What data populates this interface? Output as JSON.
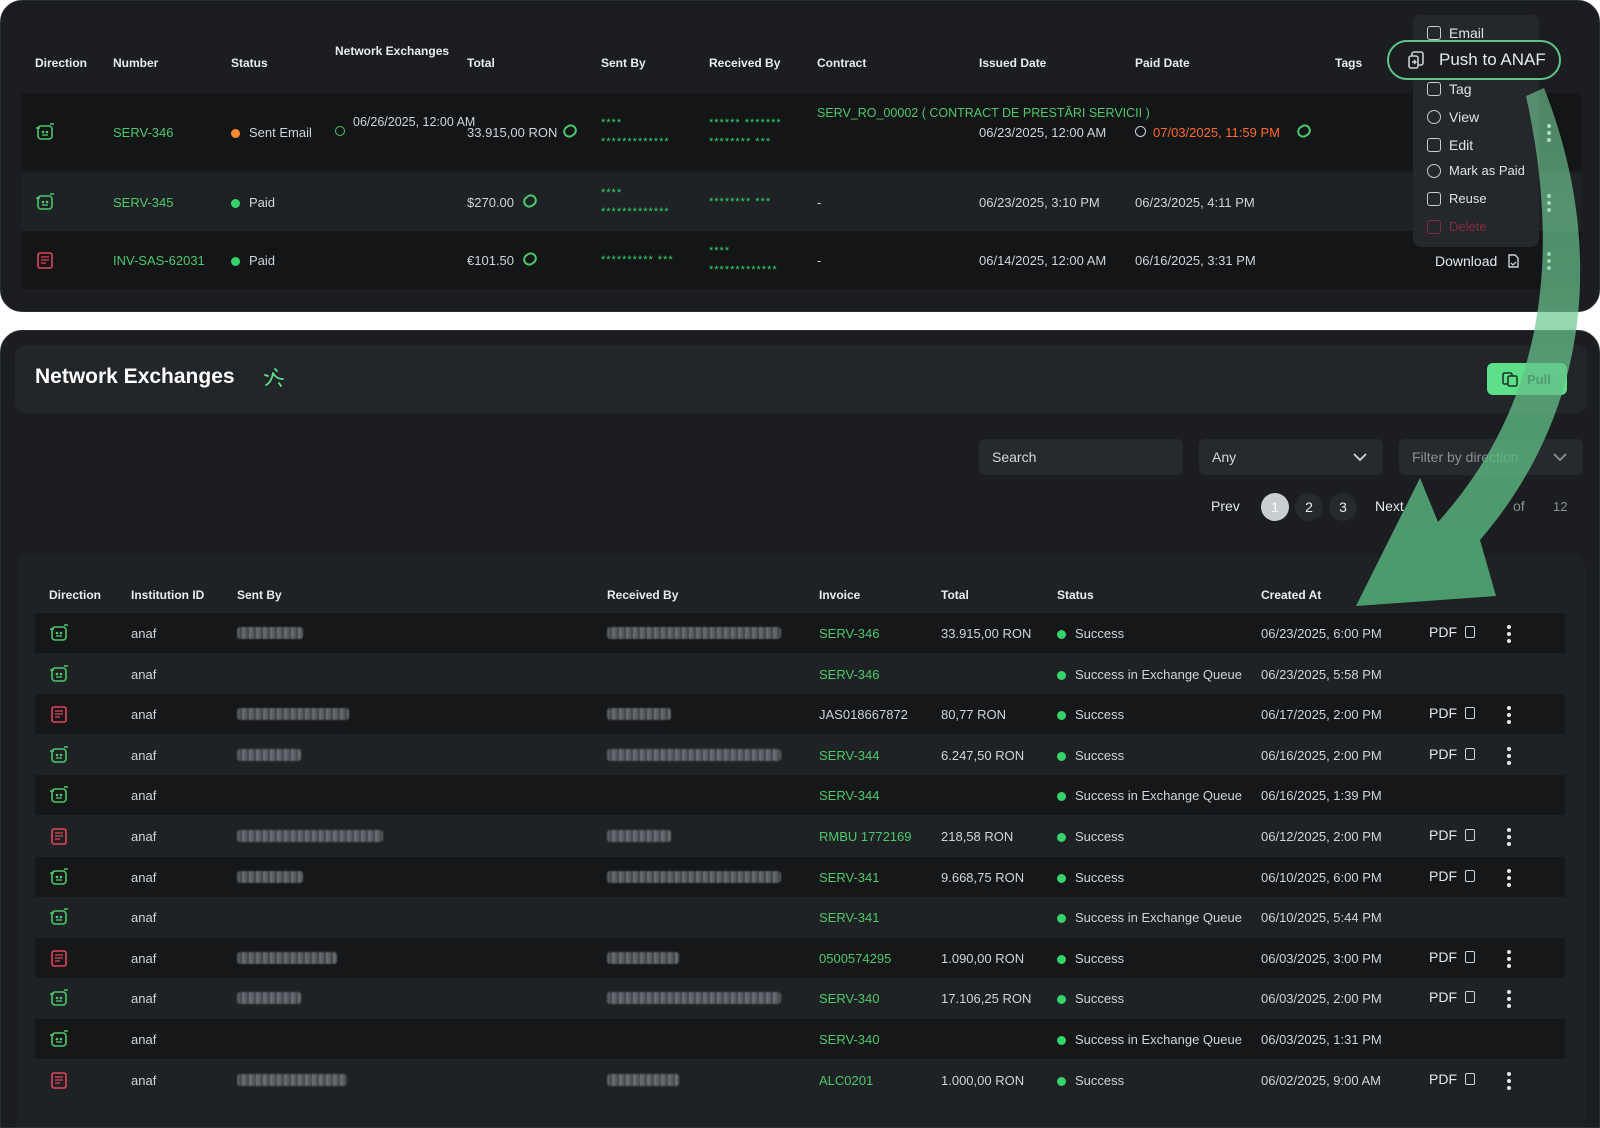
{
  "top": {
    "headers": [
      "Direction",
      "Number",
      "Status",
      "Network Exchanges",
      "Total",
      "Sent By",
      "Received By",
      "Contract",
      "Issued Date",
      "Paid Date",
      "Tags"
    ],
    "rows": [
      {
        "direction": "out",
        "number": "SERV-346",
        "status": "Sent Email",
        "status_color": "orange",
        "network": "06/26/2025, 12:00 AM",
        "total": "33.915,00 RON",
        "sent_by_1": "****",
        "sent_by_2": "*************",
        "received_by_1": "****** *******",
        "received_by_2": "******** ***",
        "contract": "SERV_RO_00002 ( CONTRACT DE PRESTĂRI SERVICII )",
        "issued": "06/23/2025, 12:00 AM",
        "paid": "07/03/2025, 11:59 PM"
      },
      {
        "direction": "out",
        "number": "SERV-345",
        "status": "Paid",
        "status_color": "green",
        "network": "",
        "total": "$270.00",
        "sent_by_1": "****",
        "sent_by_2": "*************",
        "received_by_1": "******** ***",
        "received_by_2": "",
        "contract": "-",
        "issued": "06/23/2025, 3:10 PM",
        "paid": "06/23/2025, 4:11 PM"
      },
      {
        "direction": "in",
        "number": "INV-SAS-62031",
        "status": "Paid",
        "status_color": "green",
        "network": "",
        "total": "€101.50",
        "sent_by_1": "********** ***",
        "sent_by_2": "",
        "received_by_1": "****",
        "received_by_2": "*************",
        "contract": "-",
        "issued": "06/14/2025, 12:00 AM",
        "paid": "06/16/2025, 3:31 PM"
      }
    ],
    "menu": {
      "push_label": "Push to ANAF",
      "items": [
        {
          "label": "Email",
          "icon": "email-icon"
        },
        {
          "label": "Tag",
          "icon": "tag-icon"
        },
        {
          "label": "View",
          "icon": "eye-icon"
        },
        {
          "label": "Edit",
          "icon": "edit-icon"
        },
        {
          "label": "Mark as Paid",
          "icon": "check-circle-icon"
        },
        {
          "label": "Reuse",
          "icon": "reuse-icon"
        },
        {
          "label": "Delete",
          "icon": "trash-icon"
        }
      ],
      "download_label": "Download"
    }
  },
  "exchanges": {
    "title": "Network Exchanges",
    "pull_label": "Pull",
    "search_placeholder": "Search",
    "status_select": "Any",
    "direction_placeholder": "Filter by direction",
    "pagination": {
      "prev": "Prev",
      "pages": [
        "1",
        "2",
        "3"
      ],
      "current": "1",
      "next": "Next",
      "of": "of",
      "total": "12"
    },
    "headers": [
      "Direction",
      "Institution ID",
      "Sent By",
      "Received By",
      "Invoice",
      "Total",
      "Status",
      "Created At"
    ],
    "pdf_label": "PDF",
    "rows": [
      {
        "direction": "out",
        "institution": "anaf",
        "invoice": "SERV-346",
        "invoice_green": true,
        "total": "33.915,00 RON",
        "status": "Success",
        "created": "06/23/2025, 6:00 PM",
        "pdf": true,
        "blur_sent": 66,
        "blur_recv": 174
      },
      {
        "direction": "out",
        "institution": "anaf",
        "invoice": "SERV-346",
        "invoice_green": true,
        "total": "",
        "status": "Success in Exchange Queue",
        "created": "06/23/2025, 5:58 PM",
        "pdf": false,
        "blur_sent": 0,
        "blur_recv": 0
      },
      {
        "direction": "in",
        "institution": "anaf",
        "invoice": "JAS018667872",
        "invoice_green": false,
        "total": "80,77 RON",
        "status": "Success",
        "created": "06/17/2025, 2:00 PM",
        "pdf": true,
        "blur_sent": 112,
        "blur_recv": 64
      },
      {
        "direction": "out",
        "institution": "anaf",
        "invoice": "SERV-344",
        "invoice_green": true,
        "total": "6.247,50 RON",
        "status": "Success",
        "created": "06/16/2025, 2:00 PM",
        "pdf": true,
        "blur_sent": 64,
        "blur_recv": 174
      },
      {
        "direction": "out",
        "institution": "anaf",
        "invoice": "SERV-344",
        "invoice_green": true,
        "total": "",
        "status": "Success in Exchange Queue",
        "created": "06/16/2025, 1:39 PM",
        "pdf": false,
        "blur_sent": 0,
        "blur_recv": 0
      },
      {
        "direction": "in",
        "institution": "anaf",
        "invoice": "RMBU 1772169",
        "invoice_green": true,
        "total": "218,58 RON",
        "status": "Success",
        "created": "06/12/2025, 2:00 PM",
        "pdf": true,
        "blur_sent": 146,
        "blur_recv": 64
      },
      {
        "direction": "out",
        "institution": "anaf",
        "invoice": "SERV-341",
        "invoice_green": true,
        "total": "9.668,75 RON",
        "status": "Success",
        "created": "06/10/2025, 6:00 PM",
        "pdf": true,
        "blur_sent": 66,
        "blur_recv": 174
      },
      {
        "direction": "out",
        "institution": "anaf",
        "invoice": "SERV-341",
        "invoice_green": true,
        "total": "",
        "status": "Success in Exchange Queue",
        "created": "06/10/2025, 5:44 PM",
        "pdf": false,
        "blur_sent": 0,
        "blur_recv": 0
      },
      {
        "direction": "in",
        "institution": "anaf",
        "invoice": "0500574295",
        "invoice_green": true,
        "total": "1.090,00 RON",
        "status": "Success",
        "created": "06/03/2025, 3:00 PM",
        "pdf": true,
        "blur_sent": 100,
        "blur_recv": 72
      },
      {
        "direction": "out",
        "institution": "anaf",
        "invoice": "SERV-340",
        "invoice_green": true,
        "total": "17.106,25 RON",
        "status": "Success",
        "created": "06/03/2025, 2:00 PM",
        "pdf": true,
        "blur_sent": 64,
        "blur_recv": 174
      },
      {
        "direction": "out",
        "institution": "anaf",
        "invoice": "SERV-340",
        "invoice_green": true,
        "total": "",
        "status": "Success in Exchange Queue",
        "created": "06/03/2025, 1:31 PM",
        "pdf": false,
        "blur_sent": 0,
        "blur_recv": 0
      },
      {
        "direction": "in",
        "institution": "anaf",
        "invoice": "ALC0201",
        "invoice_green": true,
        "total": "1.000,00 RON",
        "status": "Success",
        "created": "06/02/2025, 9:00 AM",
        "pdf": true,
        "blur_sent": 110,
        "blur_recv": 72
      }
    ]
  },
  "colors": {
    "accent": "#4cc86a",
    "overdue": "#ff6a2a",
    "panel": "#1b1d20",
    "pull": "#5ee08a"
  }
}
